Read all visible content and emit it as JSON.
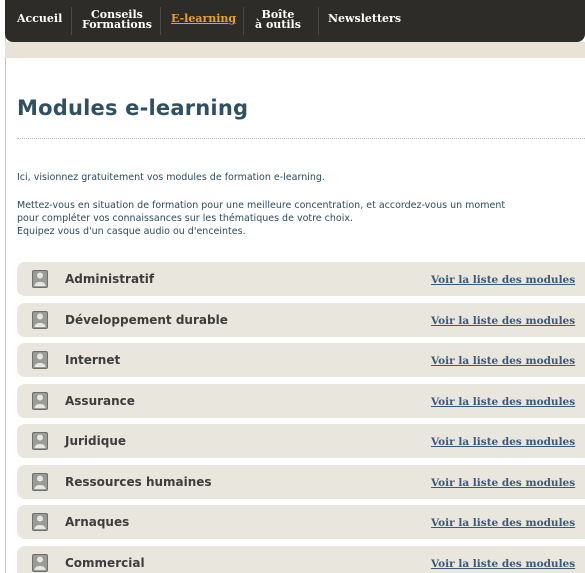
{
  "nav": {
    "items": [
      {
        "label": "Accueil"
      },
      {
        "label": "Conseils\nFormations"
      },
      {
        "label": "E-learning"
      },
      {
        "label": "Boîte\nà outils"
      },
      {
        "label": "Newsletters"
      }
    ],
    "active_index": 2,
    "active_color": "#e8a12d",
    "bar_color": "#2d2c28"
  },
  "page": {
    "title": "Modules e-learning",
    "intro": [
      "Ici, visionnez gratuitement vos modules de formation e-learning.",
      "Mettez-vous en situation de formation pour une meilleure concentration, et accordez-vous un moment",
      "pour compléter vos connaissances sur les thématiques de votre choix.",
      "Equipez vous d'un casque audio ou d'enceintes."
    ]
  },
  "modules": [
    {
      "label": "Administratif",
      "link": "Voir la liste des modules"
    },
    {
      "label": "Développement durable",
      "link": "Voir la liste des modules"
    },
    {
      "label": "Internet",
      "link": "Voir la liste des modules"
    },
    {
      "label": "Assurance",
      "link": "Voir la liste des modules"
    },
    {
      "label": "Juridique",
      "link": "Voir la liste des modules"
    },
    {
      "label": "Ressources humaines",
      "link": "Voir la liste des modules"
    },
    {
      "label": "Arnaques",
      "link": "Voir la liste des modules"
    },
    {
      "label": "Commercial",
      "link": "Voir la liste des modules"
    }
  ],
  "icons": {
    "module": "person-silhouette-icon"
  }
}
